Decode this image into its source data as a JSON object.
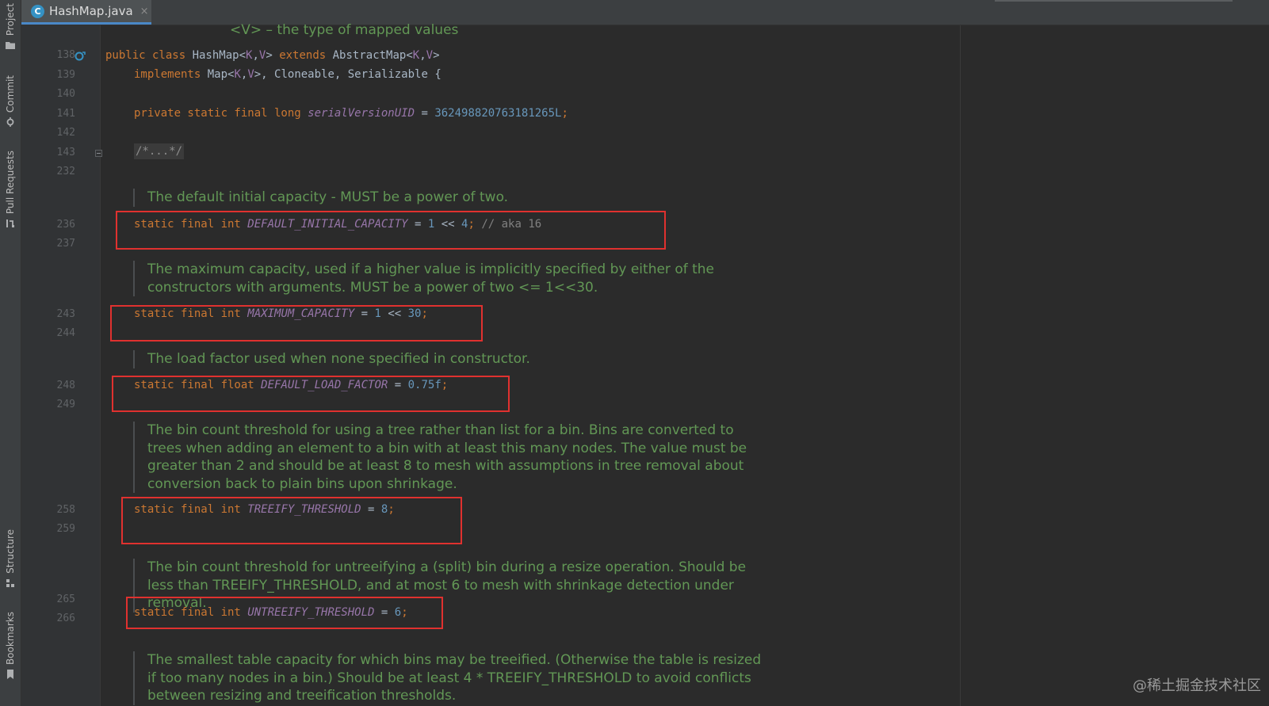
{
  "toolwindows": {
    "project": "Project",
    "commit": "Commit",
    "pull_requests": "Pull Requests",
    "structure": "Structure",
    "bookmarks": "Bookmarks"
  },
  "tab": {
    "icon_letter": "C",
    "file_name": "HashMap.java",
    "close_symbol": "×"
  },
  "line_numbers": [
    "138",
    "139",
    "140",
    "141",
    "142",
    "143",
    "232",
    "236",
    "237",
    "243",
    "244",
    "248",
    "249",
    "258",
    "259",
    "265",
    "266"
  ],
  "code": {
    "class_decl": {
      "kw1": "public class ",
      "name": "HashMap<",
      "k": "K",
      "comma": ",",
      "v": "V",
      "close": "> ",
      "kw2": "extends ",
      "parent": "AbstractMap<",
      "k2": "K",
      "comma2": ",",
      "v2": "V",
      "close2": ">"
    },
    "implements_line": {
      "kw": "implements ",
      "map": "Map<",
      "k": "K",
      "comma": ",",
      "v": "V",
      "rest": ">, Cloneable, Serializable {"
    },
    "serial_line": {
      "kw": "private static final long ",
      "field": "serialVersionUID",
      "eq": " = ",
      "value": "362498820763181265L",
      "semi": ";"
    },
    "folded_comment": "/*...*/",
    "default_capacity": {
      "kw": "static final int ",
      "field": "DEFAULT_INITIAL_CAPACITY",
      "mid": " = ",
      "a": "1",
      "op": " << ",
      "b": "4",
      "semi": "; ",
      "comment": "// aka 16"
    },
    "maximum_capacity": {
      "kw": "static final int ",
      "field": "MAXIMUM_CAPACITY",
      "mid": " = ",
      "a": "1",
      "op": " << ",
      "b": "30",
      "semi": ";"
    },
    "load_factor": {
      "kw": "static final float ",
      "field": "DEFAULT_LOAD_FACTOR",
      "mid": " = ",
      "value": "0.75f",
      "semi": ";"
    },
    "treeify": {
      "kw": "static final int ",
      "field": "TREEIFY_THRESHOLD",
      "mid": " = ",
      "value": "8",
      "semi": ";"
    },
    "untreeify": {
      "kw": "static final int ",
      "field": "UNTREEIFY_THRESHOLD",
      "mid": " = ",
      "value": "6",
      "semi": ";"
    }
  },
  "docs": {
    "top_fragment": "<V> – the type of mapped values",
    "default_capacity": "The default initial capacity - MUST be a power of two.",
    "maximum_capacity": "The maximum capacity, used if a higher value is implicitly specified by either of the constructors with arguments. MUST be a power of two <= 1<<30.",
    "load_factor": "The load factor used when none specified in constructor.",
    "treeify": "The bin count threshold for using a tree rather than list for a bin. Bins are converted to trees when adding an element to a bin with at least this many nodes. The value must be greater than 2 and should be at least 8 to mesh with assumptions in tree removal about conversion back to plain bins upon shrinkage.",
    "untreeify": "The bin count threshold for untreeifying a (split) bin during a resize operation. Should be less than TREEIFY_THRESHOLD, and at most 6 to mesh with shrinkage detection under removal.",
    "min_treeify": "The smallest table capacity for which bins may be treeified. (Otherwise the table is resized if too many nodes in a bin.) Should be at least 4 * TREEIFY_THRESHOLD to avoid conflicts between resizing and treeification thresholds."
  },
  "watermark": "@稀土掘金技术社区",
  "colors": {
    "background": "#2b2b2b",
    "keyword": "#cc7832",
    "type_param": "#9876aa",
    "number": "#6897bb",
    "doc_text": "#629755",
    "highlight_box": "#e0312f"
  }
}
